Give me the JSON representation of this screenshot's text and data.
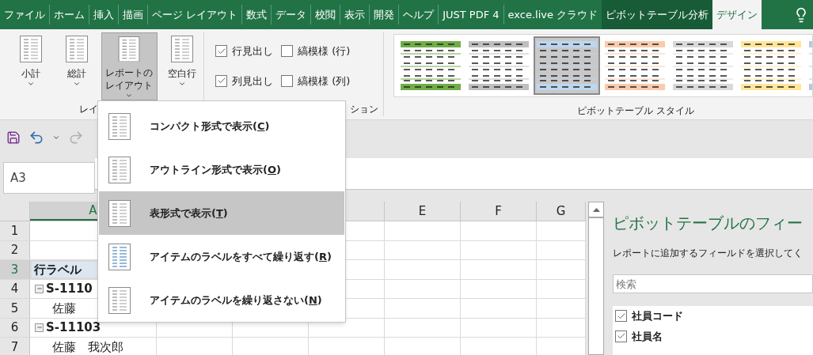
{
  "tabs": [
    {
      "label": "ファイル",
      "kind": "normal",
      "selected": false
    },
    {
      "label": "ホーム",
      "kind": "normal",
      "selected": false
    },
    {
      "label": "挿入",
      "kind": "normal",
      "selected": false
    },
    {
      "label": "描画",
      "kind": "normal",
      "selected": false
    },
    {
      "label": "ページ レイアウト",
      "kind": "normal",
      "selected": false
    },
    {
      "label": "数式",
      "kind": "normal",
      "selected": false
    },
    {
      "label": "データ",
      "kind": "normal",
      "selected": false
    },
    {
      "label": "校閲",
      "kind": "normal",
      "selected": false
    },
    {
      "label": "表示",
      "kind": "normal",
      "selected": false
    },
    {
      "label": "開発",
      "kind": "normal",
      "selected": false
    },
    {
      "label": "ヘルプ",
      "kind": "normal",
      "selected": false
    },
    {
      "label": "JUST PDF 4",
      "kind": "normal",
      "selected": false
    },
    {
      "label": "exce.live クラウド",
      "kind": "normal",
      "selected": false
    },
    {
      "label": "ピボットテーブル分析",
      "kind": "contextual",
      "selected": false
    },
    {
      "label": "デザイン",
      "kind": "contextual",
      "selected": true
    }
  ],
  "ribbon": {
    "layout_group": {
      "label": "レイ",
      "buttons": [
        {
          "label": "小計",
          "pressed": false
        },
        {
          "label": "総計",
          "pressed": false
        },
        {
          "label": "レポートのレイアウト",
          "pressed": true
        },
        {
          "label": "空白行",
          "pressed": false
        }
      ]
    },
    "options_group": {
      "label": "ション",
      "checkboxes": [
        {
          "label": "行見出し",
          "checked": true
        },
        {
          "label": "縞模様 (行)",
          "checked": false
        },
        {
          "label": "列見出し",
          "checked": true
        },
        {
          "label": "縞模様 (列)",
          "checked": false
        }
      ]
    },
    "styles_group": {
      "label": "ピボットテーブル スタイル",
      "styles": [
        {
          "color": "#70ad47",
          "selected": false
        },
        {
          "color": "#bfbfbf",
          "selected": false
        },
        {
          "color": "#bdd7ee",
          "selected": true
        },
        {
          "color": "#f8cbad",
          "selected": false
        },
        {
          "color": "#d9d9d9",
          "selected": false
        },
        {
          "color": "#ffe699",
          "selected": false
        },
        {
          "color": "#b4c7e7",
          "selected": false
        }
      ]
    }
  },
  "name_box": {
    "value": "A3"
  },
  "sheet": {
    "columns": [
      {
        "label": "A",
        "selected": true
      },
      {
        "label": "E",
        "selected": false
      },
      {
        "label": "F",
        "selected": false
      },
      {
        "label": "G",
        "selected": false
      }
    ],
    "rows": [
      {
        "number": "1",
        "selected": false,
        "kind": "blank"
      },
      {
        "number": "2",
        "selected": false,
        "kind": "blank"
      },
      {
        "number": "3",
        "selected": true,
        "kind": "header",
        "cell": "行ラベル"
      },
      {
        "number": "4",
        "selected": false,
        "kind": "group",
        "cell": "S-1110"
      },
      {
        "number": "5",
        "selected": false,
        "kind": "item",
        "cell": "佐藤"
      },
      {
        "number": "6",
        "selected": false,
        "kind": "group",
        "cell": "S-11103"
      },
      {
        "number": "7",
        "selected": false,
        "kind": "item",
        "cell": "佐藤　我次郎"
      }
    ]
  },
  "layout_menu": {
    "items": [
      {
        "label": "コンパクト形式で表示",
        "accelerator": "(C)",
        "selected": false
      },
      {
        "label": "アウトライン形式で表示",
        "accelerator": "(O)",
        "selected": false
      },
      {
        "label": "表形式で表示",
        "accelerator": "(T)",
        "selected": true
      },
      {
        "label": "アイテムのラベルをすべて繰り返す",
        "accelerator": "(R)",
        "selected": false
      },
      {
        "label": "アイテムのラベルを繰り返さない",
        "accelerator": "(N)",
        "selected": false
      }
    ]
  },
  "field_list": {
    "title": "ピボットテーブルのフィー",
    "subtitle": "レポートに追加するフィールドを選択してく",
    "search": {
      "placeholder": "検索"
    },
    "fields": [
      {
        "label": "社員コード",
        "checked": true
      },
      {
        "label": "社員名",
        "checked": true
      }
    ]
  }
}
